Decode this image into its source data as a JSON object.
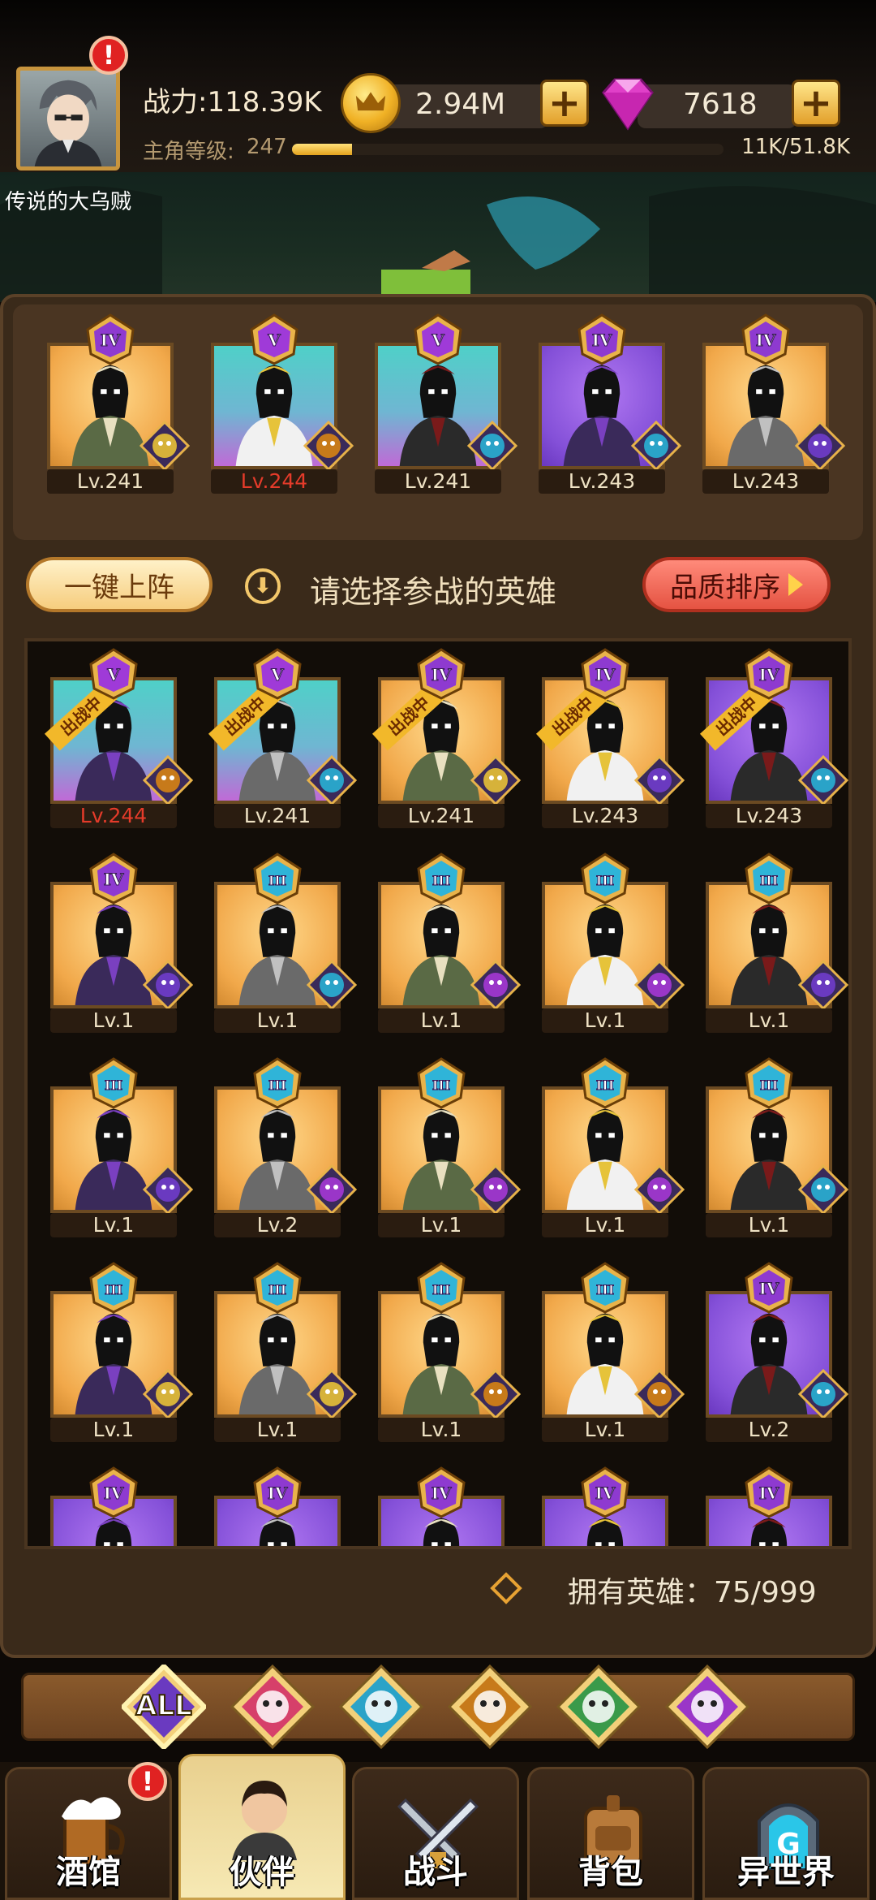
{
  "header": {
    "power_label": "战力:118.39K",
    "level_label": "主角等级:",
    "level_value": "247",
    "xp_progress": 0.14,
    "xp_text": "11K/51.8K",
    "coins": "2.94M",
    "gems": "7618",
    "alert_badge": "!"
  },
  "player_name": "传说的大乌贼",
  "lineup": [
    {
      "level": "Lv.241",
      "rank": "IV",
      "card_color": "gold",
      "faction": "elf",
      "level_red": false
    },
    {
      "level": "Lv.244",
      "rank": "V",
      "card_color": "teal",
      "faction": "beast",
      "level_red": true
    },
    {
      "level": "Lv.241",
      "rank": "V",
      "card_color": "teal",
      "faction": "sea",
      "level_red": false
    },
    {
      "level": "Lv.243",
      "rank": "IV",
      "card_color": "purple",
      "faction": "sea",
      "level_red": false
    },
    {
      "level": "Lv.243",
      "rank": "IV",
      "card_color": "gold",
      "faction": "human",
      "level_red": false
    }
  ],
  "actions": {
    "one_key_deploy": "一键上阵",
    "hint": "请选择参战的英雄",
    "sort_quality": "品质排序"
  },
  "deploy_tag": "出战中",
  "roster": [
    {
      "level": "Lv.244",
      "rank": "V",
      "card_color": "teal",
      "faction": "beast",
      "deployed": true,
      "level_red": true
    },
    {
      "level": "Lv.241",
      "rank": "V",
      "card_color": "teal",
      "faction": "sea",
      "deployed": true,
      "level_red": false
    },
    {
      "level": "Lv.241",
      "rank": "IV",
      "card_color": "gold",
      "faction": "elf",
      "deployed": true,
      "level_red": false
    },
    {
      "level": "Lv.243",
      "rank": "IV",
      "card_color": "gold",
      "faction": "human",
      "deployed": true,
      "level_red": false
    },
    {
      "level": "Lv.243",
      "rank": "IV",
      "card_color": "purple",
      "faction": "sea",
      "deployed": true,
      "level_red": false
    },
    {
      "level": "Lv.1",
      "rank": "IV",
      "card_color": "gold",
      "faction": "human",
      "deployed": false,
      "level_red": false
    },
    {
      "level": "Lv.1",
      "rank": "III",
      "card_color": "gold",
      "faction": "sea",
      "deployed": false,
      "level_red": false
    },
    {
      "level": "Lv.1",
      "rank": "III",
      "card_color": "gold",
      "faction": "demon",
      "deployed": false,
      "level_red": false
    },
    {
      "level": "Lv.1",
      "rank": "III",
      "card_color": "gold",
      "faction": "demon",
      "deployed": false,
      "level_red": false
    },
    {
      "level": "Lv.1",
      "rank": "III",
      "card_color": "gold",
      "faction": "human",
      "deployed": false,
      "level_red": false
    },
    {
      "level": "Lv.1",
      "rank": "III",
      "card_color": "gold",
      "faction": "human",
      "deployed": false,
      "level_red": false
    },
    {
      "level": "Lv.2",
      "rank": "III",
      "card_color": "gold",
      "faction": "demon",
      "deployed": false,
      "level_red": false
    },
    {
      "level": "Lv.1",
      "rank": "III",
      "card_color": "gold",
      "faction": "demon",
      "deployed": false,
      "level_red": false
    },
    {
      "level": "Lv.1",
      "rank": "III",
      "card_color": "gold",
      "faction": "demon",
      "deployed": false,
      "level_red": false
    },
    {
      "level": "Lv.1",
      "rank": "III",
      "card_color": "gold",
      "faction": "sea",
      "deployed": false,
      "level_red": false
    },
    {
      "level": "Lv.1",
      "rank": "III",
      "card_color": "gold",
      "faction": "elf",
      "deployed": false,
      "level_red": false
    },
    {
      "level": "Lv.1",
      "rank": "III",
      "card_color": "gold",
      "faction": "elf",
      "deployed": false,
      "level_red": false
    },
    {
      "level": "Lv.1",
      "rank": "III",
      "card_color": "gold",
      "faction": "beast",
      "deployed": false,
      "level_red": false
    },
    {
      "level": "Lv.1",
      "rank": "III",
      "card_color": "gold",
      "faction": "beast",
      "deployed": false,
      "level_red": false
    },
    {
      "level": "Lv.2",
      "rank": "IV",
      "card_color": "purple",
      "faction": "sea",
      "deployed": false,
      "level_red": false
    },
    {
      "level": "",
      "rank": "IV",
      "card_color": "purple",
      "faction": "",
      "deployed": false,
      "level_red": false
    },
    {
      "level": "",
      "rank": "IV",
      "card_color": "purple",
      "faction": "",
      "deployed": false,
      "level_red": false
    },
    {
      "level": "",
      "rank": "IV",
      "card_color": "purple",
      "faction": "",
      "deployed": false,
      "level_red": false
    },
    {
      "level": "",
      "rank": "IV",
      "card_color": "purple",
      "faction": "",
      "deployed": false,
      "level_red": false
    },
    {
      "level": "",
      "rank": "IV",
      "card_color": "purple",
      "faction": "",
      "deployed": false,
      "level_red": false
    }
  ],
  "owned_heroes": "拥有英雄：75/999",
  "filters": [
    {
      "label": "ALL",
      "icon": "all-icon",
      "selected": true
    },
    {
      "label": "",
      "icon": "human-faction-icon",
      "selected": false
    },
    {
      "label": "",
      "icon": "sea-faction-icon",
      "selected": false
    },
    {
      "label": "",
      "icon": "beast-faction-icon",
      "selected": false
    },
    {
      "label": "",
      "icon": "elf-faction-icon",
      "selected": false
    },
    {
      "label": "",
      "icon": "demon-faction-icon",
      "selected": false
    }
  ],
  "nav": [
    {
      "label": "酒馆",
      "icon": "tavern-mug-icon",
      "active": false,
      "badge": "!"
    },
    {
      "label": "伙伴",
      "icon": "partner-icon",
      "active": true,
      "badge": ""
    },
    {
      "label": "战斗",
      "icon": "crossed-swords-icon",
      "active": false,
      "badge": ""
    },
    {
      "label": "背包",
      "icon": "backpack-icon",
      "active": false,
      "badge": ""
    },
    {
      "label": "异世界",
      "icon": "portal-icon",
      "active": false,
      "badge": ""
    }
  ],
  "colors": {
    "card_gold": "#f1a84a",
    "card_teal": "#4fd0c8",
    "card_purple": "#8450d8",
    "level_red": "#e53b2a",
    "accent_gold": "#e3a21d"
  }
}
